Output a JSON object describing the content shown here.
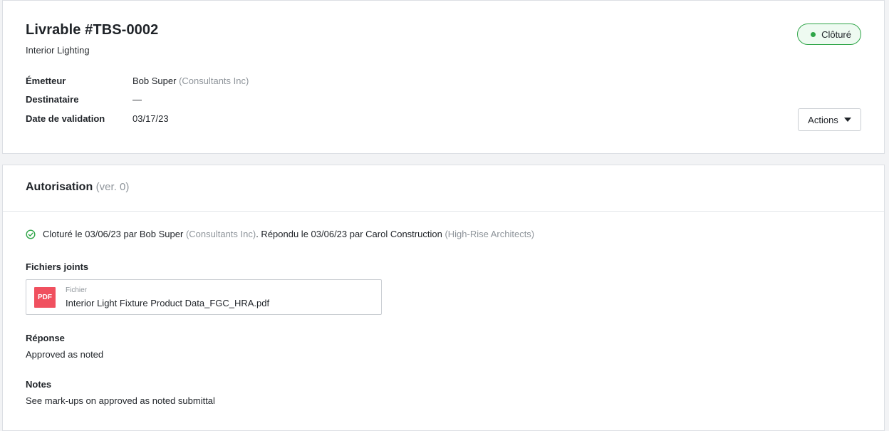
{
  "header": {
    "title": "Livrable #TBS-0002",
    "subtitle": "Interior Lighting",
    "status": "Clôturé",
    "actions_label": "Actions"
  },
  "meta": [
    {
      "label": "Émetteur",
      "value": "Bob Super",
      "org": "(Consultants Inc)"
    },
    {
      "label": "Destinataire",
      "value": "—"
    },
    {
      "label": "Date de validation",
      "value": "03/17/23"
    }
  ],
  "authorization": {
    "title": "Autorisation",
    "version": "(ver. 0)",
    "status_line": {
      "closed_text": "Cloturé le 03/06/23 par Bob Super",
      "closed_org": "(Consultants Inc)",
      "response_text": ". Répondu le 03/06/23 par Carol Construction",
      "response_org": "(High-Rise Architects)"
    },
    "attachments_label": "Fichiers joints",
    "file": {
      "type_badge": "PDF",
      "kind": "Fichier",
      "name": "Interior Light Fixture Product Data_FGC_HRA.pdf"
    },
    "response_label": "Réponse",
    "response_value": "Approved as noted",
    "notes_label": "Notes",
    "notes_value": "See mark-ups on approved as noted submittal"
  },
  "colors": {
    "status_green": "#2fa548",
    "pdf_red": "#f0505f",
    "muted_text": "#8e949a"
  }
}
